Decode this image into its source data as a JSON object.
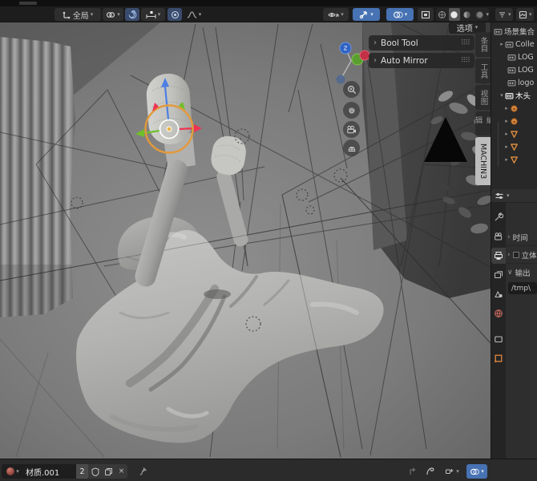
{
  "icons": {
    "caret": "▾",
    "chevron_collapsed": "›",
    "chevron_expanded": "∨",
    "expander_collapsed": "▸",
    "expander_expanded": "▾",
    "close": "×",
    "drag_handle": "⠿⠿"
  },
  "colors": {
    "accent_blue": "#4772b3",
    "gizmo_orange": "#e39a3b",
    "axis_x_red": "#ee3352",
    "axis_y_green": "#6fbf2a",
    "axis_z_blue": "#4d7fe3",
    "header_bg": "#1d1d1d",
    "active_tab_bg": "#bdbdbd"
  },
  "toolbar": {
    "orientation_label": "全局"
  },
  "viewport": {
    "options_button": "选项",
    "overlay_panels": [
      {
        "label": "Bool Tool"
      },
      {
        "label": "Auto Mirror"
      }
    ],
    "sidebar_tabs": [
      {
        "label": "条目"
      },
      {
        "label": "工具"
      },
      {
        "label": "视图"
      },
      {
        "label": "编辑"
      },
      {
        "label": "MACHIN3"
      }
    ],
    "axis_gizmo": {
      "z_label": "Z"
    }
  },
  "outliner": {
    "rows": [
      {
        "label": "场景集合",
        "expander": ""
      },
      {
        "label": "Colle",
        "expander": "▸"
      },
      {
        "label": "LOG",
        "expander": ""
      },
      {
        "label": "LOG",
        "expander": ""
      },
      {
        "label": "logo",
        "expander": ""
      },
      {
        "label": "木头",
        "expander": "▾"
      },
      {
        "label": "",
        "expander": "▸"
      },
      {
        "label": "",
        "expander": "▸"
      },
      {
        "label": "",
        "expander": "▸"
      },
      {
        "label": "",
        "expander": "▸"
      },
      {
        "label": "",
        "expander": "▸"
      }
    ]
  },
  "properties": {
    "panels": [
      {
        "label": "时间"
      },
      {
        "label": "立体"
      },
      {
        "label": "输出"
      }
    ],
    "output_path": "/tmp\\"
  },
  "statusbar": {
    "material_name": "材质.001",
    "users_count": "2"
  }
}
